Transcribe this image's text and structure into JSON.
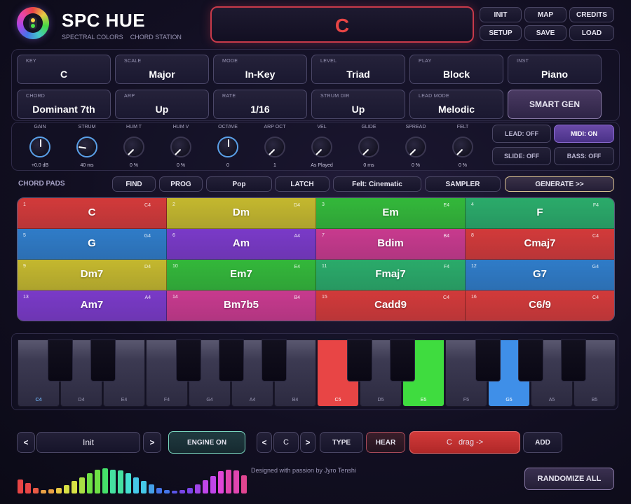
{
  "app": {
    "title": "SPC HUE",
    "subtitle": "SPECTRAL COLORS    CHORD STATION"
  },
  "display": {
    "chord": "C"
  },
  "top_buttons": [
    "INIT",
    "MAP",
    "CREDITS",
    "SETUP",
    "SAVE",
    "LOAD"
  ],
  "selectors_row1": [
    {
      "label": "KEY",
      "value": "C"
    },
    {
      "label": "SCALE",
      "value": "Major"
    },
    {
      "label": "MODE",
      "value": "In-Key"
    },
    {
      "label": "LEVEL",
      "value": "Triad"
    },
    {
      "label": "PLAY",
      "value": "Block"
    },
    {
      "label": "INST",
      "value": "Piano"
    }
  ],
  "selectors_row2": [
    {
      "label": "CHORD",
      "value": "Dominant 7th"
    },
    {
      "label": "ARP",
      "value": "Up"
    },
    {
      "label": "RATE",
      "value": "1/16"
    },
    {
      "label": "STRUM DIR",
      "value": "Up"
    },
    {
      "label": "LEAD MODE",
      "value": "Melodic"
    }
  ],
  "smart_gen": "SMART GEN",
  "knobs": [
    {
      "label": "GAIN",
      "value": "+0.0 dB",
      "level": 0.5
    },
    {
      "label": "STRUM",
      "value": "40 ms",
      "level": 0.2
    },
    {
      "label": "HUM T",
      "value": "0 %",
      "level": 0
    },
    {
      "label": "HUM V",
      "value": "0 %",
      "level": 0
    },
    {
      "label": "OCTAVE",
      "value": "0",
      "level": 0.5
    },
    {
      "label": "ARP OCT",
      "value": "1",
      "level": 0
    },
    {
      "label": "VEL",
      "value": "As Played",
      "level": 0
    },
    {
      "label": "GLIDE",
      "value": "0 ms",
      "level": 0
    },
    {
      "label": "SPREAD",
      "value": "0 %",
      "level": 0
    },
    {
      "label": "FELT",
      "value": "0 %",
      "level": 0
    }
  ],
  "toggles": [
    {
      "label": "LEAD: OFF",
      "on": false
    },
    {
      "label": "MIDI: ON",
      "on": true
    },
    {
      "label": "SLIDE: OFF",
      "on": false
    },
    {
      "label": "BASS: OFF",
      "on": false
    }
  ],
  "chord_pads_label": "CHORD PADS",
  "pad_tools": [
    "FIND",
    "PROG",
    "Pop",
    "LATCH",
    "Felt: Cinematic",
    "SAMPLER"
  ],
  "generate": "GENERATE >>",
  "pads": [
    {
      "num": "1",
      "chord": "C",
      "oct": "C4",
      "color": "#d23a3a"
    },
    {
      "num": "2",
      "chord": "Dm",
      "oct": "D4",
      "color": "#c4b82e"
    },
    {
      "num": "3",
      "chord": "Em",
      "oct": "E4",
      "color": "#33b83a"
    },
    {
      "num": "4",
      "chord": "F",
      "oct": "F4",
      "color": "#2aab6a"
    },
    {
      "num": "5",
      "chord": "G",
      "oct": "G4",
      "color": "#2f7cc8"
    },
    {
      "num": "6",
      "chord": "Am",
      "oct": "A4",
      "color": "#7a3ac8"
    },
    {
      "num": "7",
      "chord": "Bdim",
      "oct": "B4",
      "color": "#c83a8e"
    },
    {
      "num": "8",
      "chord": "Cmaj7",
      "oct": "C4",
      "color": "#d23a3a"
    },
    {
      "num": "9",
      "chord": "Dm7",
      "oct": "D4",
      "color": "#c4b82e"
    },
    {
      "num": "10",
      "chord": "Em7",
      "oct": "E4",
      "color": "#33b83a"
    },
    {
      "num": "11",
      "chord": "Fmaj7",
      "oct": "F4",
      "color": "#2aab6a"
    },
    {
      "num": "12",
      "chord": "G7",
      "oct": "G4",
      "color": "#2f7cc8"
    },
    {
      "num": "13",
      "chord": "Am7",
      "oct": "A4",
      "color": "#7a3ac8"
    },
    {
      "num": "14",
      "chord": "Bm7b5",
      "oct": "B4",
      "color": "#c83a8e"
    },
    {
      "num": "15",
      "chord": "Cadd9",
      "oct": "C4",
      "color": "#d23a3a"
    },
    {
      "num": "16",
      "chord": "C6/9",
      "oct": "C4",
      "color": "#d23a3a"
    }
  ],
  "keyboard": {
    "white_keys": [
      {
        "label": "C4",
        "active": ""
      },
      {
        "label": "D4",
        "active": ""
      },
      {
        "label": "E4",
        "active": ""
      },
      {
        "label": "F4",
        "active": ""
      },
      {
        "label": "G4",
        "active": ""
      },
      {
        "label": "A4",
        "active": ""
      },
      {
        "label": "B4",
        "active": ""
      },
      {
        "label": "C5",
        "active": "#e84545"
      },
      {
        "label": "D5",
        "active": ""
      },
      {
        "label": "E5",
        "active": "#3fdc3f"
      },
      {
        "label": "F5",
        "active": ""
      },
      {
        "label": "G5",
        "active": "#3f8fe8"
      },
      {
        "label": "A5",
        "active": ""
      },
      {
        "label": "B5",
        "active": ""
      }
    ]
  },
  "bottom": {
    "prev": "<",
    "preset": "Init",
    "next": ">",
    "engine": "ENGINE ON",
    "key_prev": "<",
    "key": "C",
    "key_next": ">",
    "type": "TYPE",
    "hear": "HEAR",
    "drag": "C   drag ->",
    "add": "ADD",
    "credit": "Designed with passion by Jyro Tenshi",
    "randomize": "RANDOMIZE ALL"
  },
  "meter_levels": [
    0.48,
    0.35,
    0.2,
    0.12,
    0.14,
    0.2,
    0.28,
    0.42,
    0.55,
    0.7,
    0.82,
    0.85,
    0.82,
    0.78,
    0.68,
    0.55,
    0.42,
    0.3,
    0.2,
    0.12,
    0.1,
    0.12,
    0.18,
    0.3,
    0.45,
    0.6,
    0.75,
    0.82,
    0.78,
    0.62
  ]
}
